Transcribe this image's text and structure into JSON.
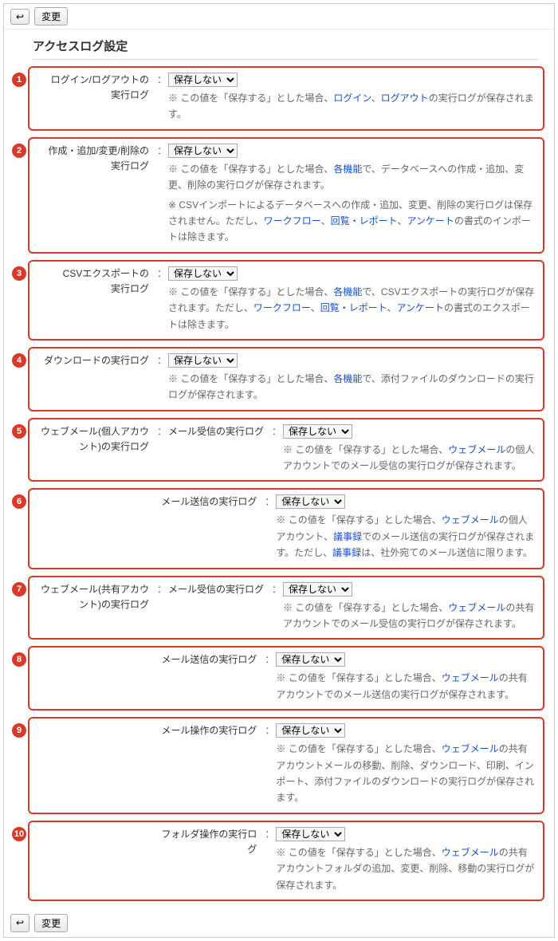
{
  "toolbar": {
    "back": "↩",
    "change": "変更"
  },
  "title": "アクセスログ設定",
  "select_default": "保存しない",
  "sep": "：",
  "star": "※",
  "sections": [
    {
      "n": "1",
      "label1": "ログイン/ログアウトの",
      "label2": "実行ログ",
      "desc_a": " この値を「保存する」とした場合、",
      "link1": "ログイン",
      "mid": "、",
      "link2": "ログアウト",
      "desc_b": "の実行ログが保存されます。"
    },
    {
      "n": "2",
      "label1": "作成・追加/変更/削除の",
      "label2": "実行ログ",
      "desc_a": " この値を「保存する」とした場合、",
      "link1": "各機能",
      "desc_b": "で、データベースへの作成・追加、変更、削除の実行ログが保存されます。",
      "desc2_a": " CSVインポートによるデータベースへの作成・追加、変更、削除の実行ログは保存されません。ただし、",
      "link2a": "ワークフロー",
      "mid2a": "、",
      "link2b": "回覧・レポート",
      "mid2b": "、",
      "link2c": "アンケート",
      "desc2_b": "の書式のインポートは除きます。"
    },
    {
      "n": "3",
      "label1": "CSVエクスポートの",
      "label2": "実行ログ",
      "desc_a": " この値を「保存する」とした場合、",
      "link1": "各機能",
      "desc_b": "で、CSVエクスポートの実行ログが保存されます。ただし、",
      "link2a": "ワークフロー",
      "mid2a": "、",
      "link2b": "回覧・レポート",
      "mid2b": "、",
      "link2c": "アンケート",
      "desc_c": "の書式のエクスポートは除きます。"
    },
    {
      "n": "4",
      "label1": "ダウンロードの実行ログ",
      "desc_a": " この値を「保存する」とした場合、",
      "link1": "各機能",
      "desc_b": "で、添付ファイルのダウンロードの実行ログが保存されます。"
    },
    {
      "n": "5",
      "label1": "ウェブメール(個人アカウ",
      "label2": "ント)の実行ログ",
      "sublabel": "メール受信の実行ログ",
      "desc_a": " この値を「保存する」とした場合、",
      "link1": "ウェブメール",
      "desc_b": "の個人アカウントでのメール受信の実行ログが保存されます。"
    },
    {
      "n": "6",
      "sublabel": "メール送信の実行ログ",
      "desc_a": " この値を「保存する」とした場合、",
      "link1": "ウェブメール",
      "desc_b": "の個人アカウント、",
      "link2": "議事録",
      "desc_c": "でのメール送信の実行ログが保存されます。ただし、",
      "link3": "議事録",
      "desc_d": "は、社外宛てのメール送信に限ります。"
    },
    {
      "n": "7",
      "label1": "ウェブメール(共有アカウ",
      "label2": "ント)の実行ログ",
      "sublabel": "メール受信の実行ログ",
      "desc_a": " この値を「保存する」とした場合、",
      "link1": "ウェブメール",
      "desc_b": "の共有アカウントでのメール受信の実行ログが保存されます。"
    },
    {
      "n": "8",
      "sublabel": "メール送信の実行ログ",
      "desc_a": " この値を「保存する」とした場合、",
      "link1": "ウェブメール",
      "desc_b": "の共有アカウントでのメール送信の実行ログが保存されます。"
    },
    {
      "n": "9",
      "sublabel": "メール操作の実行ログ",
      "desc_a": " この値を「保存する」とした場合、",
      "link1": "ウェブメール",
      "desc_b": "の共有アカウントメールの移動、削除、ダウンロード、印刷、インポート、添付ファイルのダウンロードの実行ログが保存されます。"
    },
    {
      "n": "10",
      "sublabel": "フォルダ操作の実行ログ",
      "desc_a": " この値を「保存する」とした場合、",
      "link1": "ウェブメール",
      "desc_b": "の共有アカウントフォルダの追加、変更、削除、移動の実行ログが保存されます。"
    }
  ]
}
